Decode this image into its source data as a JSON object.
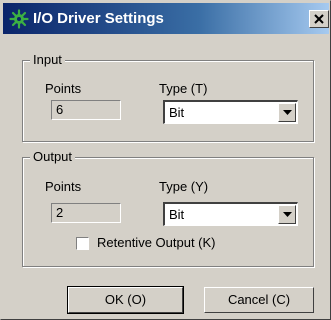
{
  "window": {
    "title": "I/O Driver Settings",
    "icon": "io-driver-gear-icon",
    "close_icon": "close-icon"
  },
  "input_group": {
    "legend": "Input",
    "points_label": "Points",
    "points_value": "6",
    "type_label": "Type (T)",
    "type_value": "Bit"
  },
  "output_group": {
    "legend": "Output",
    "points_label": "Points",
    "points_value": "2",
    "type_label": "Type (Y)",
    "type_value": "Bit",
    "retentive_label": "Retentive Output (K)",
    "retentive_checked": false
  },
  "buttons": {
    "ok": "OK (O)",
    "cancel": "Cancel (C)"
  },
  "colors": {
    "title_bar_start": "#0a246a",
    "title_bar_end": "#a6caf0",
    "face": "#d4d0c8"
  }
}
